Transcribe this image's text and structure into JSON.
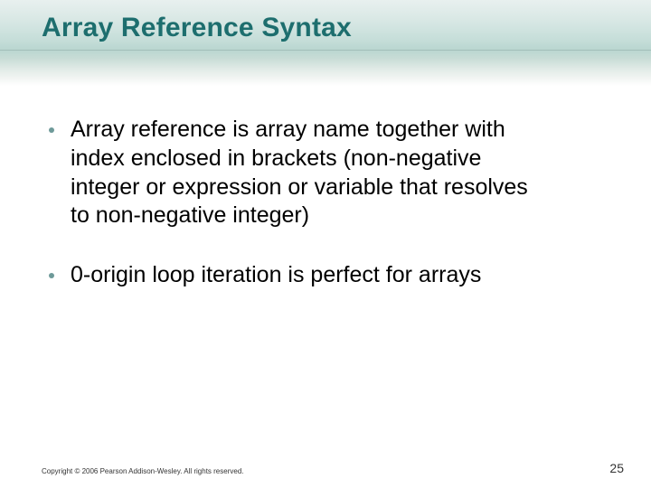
{
  "slide": {
    "title": "Array Reference Syntax",
    "bullets": [
      "Array reference is array name together with index enclosed in brackets (non-negative integer or expression or variable that resolves to non-negative integer)",
      "0-origin loop iteration is perfect for arrays"
    ],
    "copyright": "Copyright © 2006 Pearson Addison-Wesley. All rights reserved.",
    "page_number": "25"
  }
}
